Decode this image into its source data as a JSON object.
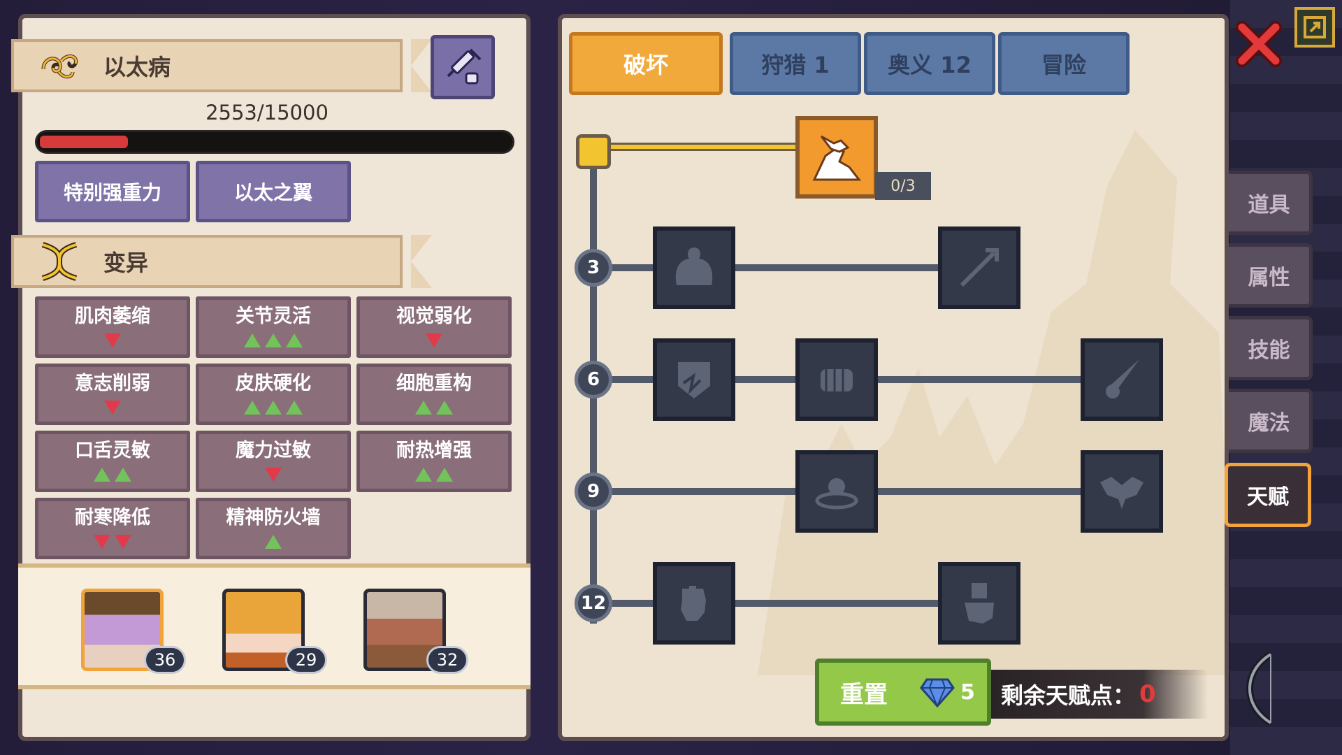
{
  "left": {
    "disease": {
      "title": "以太病",
      "icon": "ether-tentacle-icon",
      "side_icon": "syringe-icon"
    },
    "hp": {
      "text": "2553/15000",
      "current": 2553,
      "max": 15000,
      "color": "#d63a3a"
    },
    "skills": [
      "特别强重力",
      "以太之翼"
    ],
    "mutation_header": {
      "title": "变异",
      "icon": "dna-icon"
    },
    "mutations": [
      {
        "name": "肌肉萎缩",
        "direction": "down",
        "count": 1
      },
      {
        "name": "关节灵活",
        "direction": "up",
        "count": 3
      },
      {
        "name": "视觉弱化",
        "direction": "down",
        "count": 1
      },
      {
        "name": "意志削弱",
        "direction": "down",
        "count": 1
      },
      {
        "name": "皮肤硬化",
        "direction": "up",
        "count": 3
      },
      {
        "name": "细胞重构",
        "direction": "up",
        "count": 2
      },
      {
        "name": "口舌灵敏",
        "direction": "up",
        "count": 2
      },
      {
        "name": "魔力过敏",
        "direction": "down",
        "count": 1
      },
      {
        "name": "耐热增强",
        "direction": "up",
        "count": 2
      },
      {
        "name": "耐寒降低",
        "direction": "down",
        "count": 2
      },
      {
        "name": "精神防火墙",
        "direction": "up",
        "count": 1
      }
    ],
    "party": [
      {
        "level": "36",
        "portrait": "purple-hair-hero-portrait",
        "selected": true
      },
      {
        "level": "29",
        "portrait": "blonde-hero-portrait",
        "selected": false
      },
      {
        "level": "32",
        "portrait": "armored-hero-portrait",
        "selected": false
      }
    ]
  },
  "tabs": [
    {
      "label": "破坏",
      "active": true
    },
    {
      "label": "狩猎 1",
      "active": false
    },
    {
      "label": "奥义 12",
      "active": false
    },
    {
      "label": "冒险",
      "active": false
    }
  ],
  "tree": {
    "top_talent": {
      "icon": "arm-wrestle-icon",
      "progress": "0/3"
    },
    "tiers": [
      {
        "level": "3",
        "talents": [
          "muscle-body-icon",
          "arrow-shot-icon"
        ]
      },
      {
        "level": "6",
        "talents": [
          "shield-break-icon",
          "punch-fist-icon",
          "blade-slash-icon"
        ]
      },
      {
        "level": "9",
        "talents": [
          "shockwave-icon",
          "bat-wings-icon"
        ]
      },
      {
        "level": "12",
        "talents": [
          "raised-fist-icon",
          "gauntlet-icon"
        ]
      }
    ]
  },
  "reset": {
    "label": "重置",
    "cost": "5",
    "cost_icon": "diamond-icon"
  },
  "points": {
    "label": "剩余天赋点：",
    "value": "0"
  },
  "side_tabs": [
    {
      "label": "道具",
      "active": false
    },
    {
      "label": "属性",
      "active": false
    },
    {
      "label": "技能",
      "active": false
    },
    {
      "label": "魔法",
      "active": false
    },
    {
      "label": "天赋",
      "active": true
    }
  ],
  "hud": {
    "close_icon": "close-x-icon",
    "exit_icon": "exit-door-icon",
    "bow_icon": "bow-icon"
  }
}
